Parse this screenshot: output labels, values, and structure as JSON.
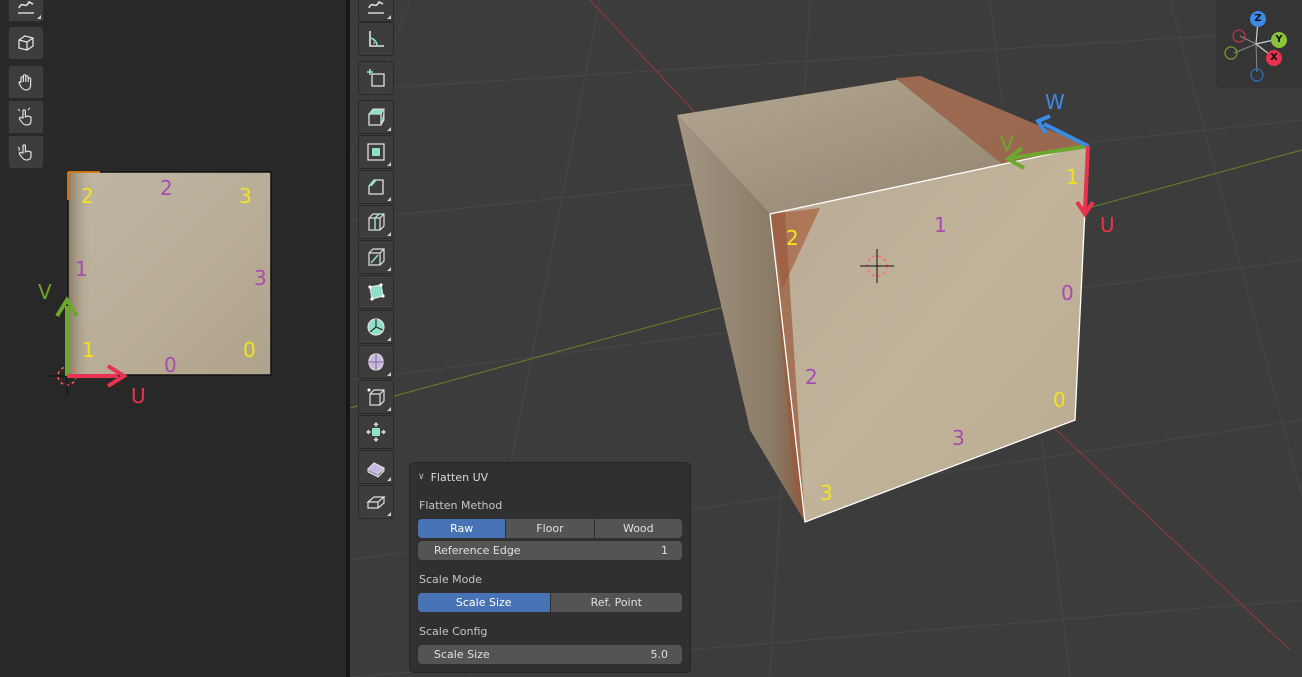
{
  "colors": {
    "accent": "#4772b3",
    "axis_u": "#e8324f",
    "axis_v": "#6da72e",
    "axis_w": "#3a8ae6",
    "vertex_label": "#f5e21b",
    "edge_label": "#a84bb0"
  },
  "uv_editor": {
    "tools": [
      {
        "icon": "annotate-icon"
      },
      {
        "icon": "cube-grab-icon"
      },
      {
        "icon": "grab-hand-icon"
      },
      {
        "icon": "pinch-hand-icon"
      },
      {
        "icon": "relax-hand-icon"
      }
    ],
    "axis_labels": {
      "u": "U",
      "v": "V"
    },
    "vertex_labels": {
      "top_left": "2",
      "top_right": "3",
      "bottom_left": "1",
      "bottom_right": "0"
    },
    "edge_labels": {
      "top": "2",
      "left": "1",
      "right": "3",
      "bottom": "0"
    }
  },
  "viewport": {
    "tools": [
      {
        "icon": "annotate-icon"
      },
      {
        "icon": "measure-icon"
      },
      {
        "icon": "add-cube-icon"
      },
      {
        "icon": "extrude-region-icon"
      },
      {
        "icon": "inset-faces-icon"
      },
      {
        "icon": "bevel-icon"
      },
      {
        "icon": "loop-cut-icon"
      },
      {
        "icon": "knife-icon"
      },
      {
        "icon": "poly-build-icon"
      },
      {
        "icon": "spin-icon"
      },
      {
        "icon": "smooth-icon"
      },
      {
        "icon": "edge-slide-icon"
      },
      {
        "icon": "shrink-fatten-icon"
      },
      {
        "icon": "shear-icon"
      },
      {
        "icon": "rip-region-icon"
      }
    ],
    "gizmo": {
      "x": "X",
      "y": "Y",
      "z": "Z"
    },
    "axis_labels": {
      "u": "U",
      "v": "V",
      "w": "W"
    },
    "vertex_labels": {
      "top_right": "1",
      "top_left": "2",
      "bottom_right": "0",
      "bottom_left": "3"
    },
    "edge_labels": {
      "top": "1",
      "right": "0",
      "left": "2",
      "bottom": "3"
    }
  },
  "flatten_panel": {
    "title": "Flatten UV",
    "flatten_method": {
      "label": "Flatten Method",
      "options": [
        "Raw",
        "Floor",
        "Wood"
      ],
      "selected": "Raw"
    },
    "reference_edge": {
      "label": "Reference Edge",
      "value": "1"
    },
    "scale_mode": {
      "label": "Scale Mode",
      "options": [
        "Scale Size",
        "Ref. Point"
      ],
      "selected": "Scale Size"
    },
    "scale_config": {
      "label": "Scale Config",
      "field": {
        "label": "Scale Size",
        "value": "5.0"
      }
    }
  }
}
